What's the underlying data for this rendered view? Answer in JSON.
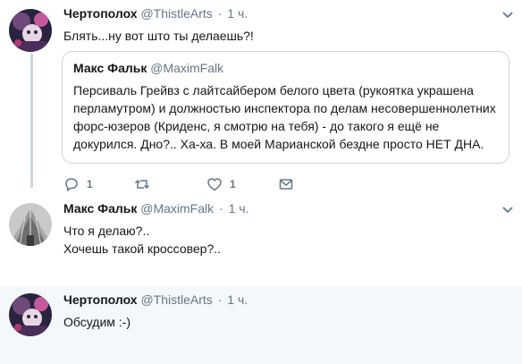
{
  "tweets": [
    {
      "author_name": "Чертополох",
      "author_handle": "@ThistleArts",
      "separator": "·",
      "time": "1 ч.",
      "text": "Блять...ну вот што ты делаешь?!",
      "quote": {
        "author_name": "Макс Фальк",
        "author_handle": "@MaximFalk",
        "text": "Персиваль Грейвз с лайтсайбером белого цвета (рукоятка украшена перламутром) и должностью инспектора по делам несовершеннолетних форс-юзеров (Криденс, я смотрю на тебя) - до такого я ещё не докурился. Дно?.. Ха-ха. В моей Марианской бездне просто НЕТ ДНА."
      },
      "reply_count": "1",
      "retweet_count": "",
      "like_count": "1"
    },
    {
      "author_name": "Макс Фальк",
      "author_handle": "@MaximFalk",
      "separator": "·",
      "time": "1 ч.",
      "text_lines": [
        "Что я делаю?..",
        "Хочешь такой кроссовер?.."
      ]
    },
    {
      "author_name": "Чертополох",
      "author_handle": "@ThistleArts",
      "separator": "·",
      "time": "1 ч.",
      "text": "Обсудим :-)"
    }
  ],
  "icons": {
    "reply": "reply-icon",
    "retweet": "retweet-icon",
    "like": "heart-icon",
    "dm": "envelope-icon",
    "more": "chevron-down-icon"
  },
  "colors": {
    "text": "#14171a",
    "secondary": "#657786",
    "border": "#ccd6dd",
    "highlight_bg": "#f5f8fa"
  }
}
